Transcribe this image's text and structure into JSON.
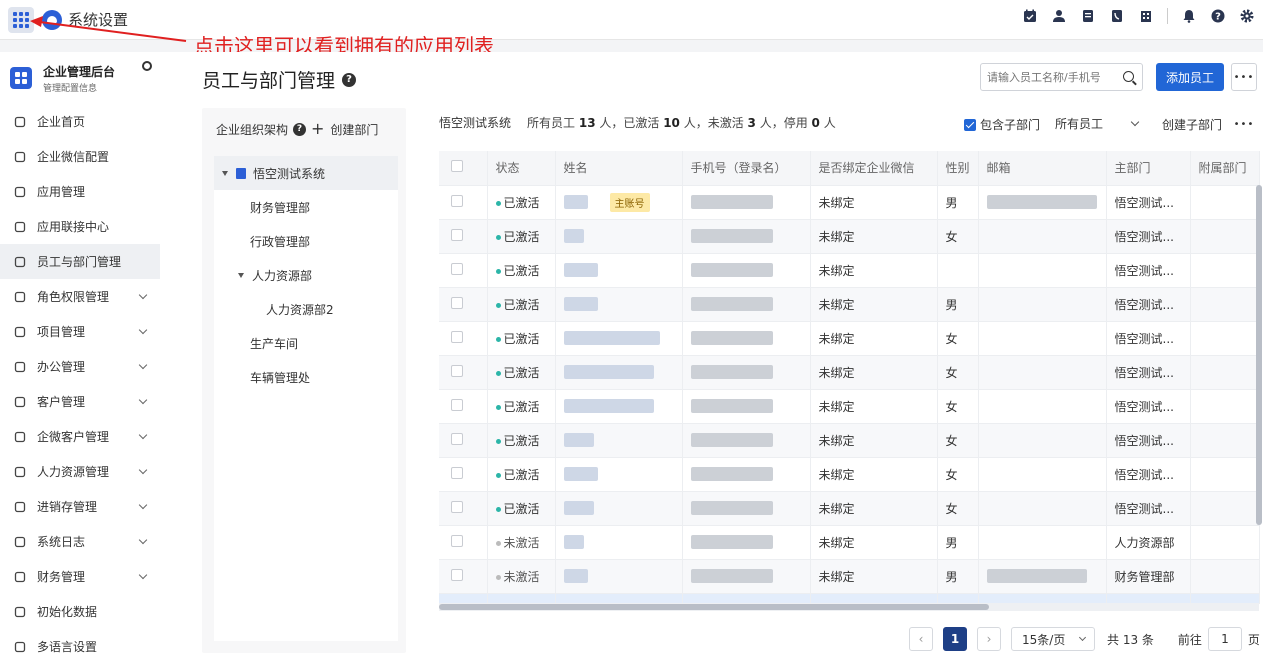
{
  "topbar": {
    "title": "系统设置",
    "annotation": "点击这里可以看到拥有的应用列表",
    "annotation_color": "#e02020",
    "icons": [
      "calendar-check-icon",
      "user-icon",
      "document-icon",
      "phone-book-icon",
      "building-icon",
      "bell-icon",
      "help-icon",
      "settings-icon"
    ]
  },
  "sidebar": {
    "title": "企业管理后台",
    "subtitle": "管理配置信息",
    "items": [
      {
        "label": "企业首页",
        "icon": "home-icon",
        "expandable": false
      },
      {
        "label": "企业微信配置",
        "icon": "wechat-icon",
        "expandable": false
      },
      {
        "label": "应用管理",
        "icon": "apps-icon",
        "expandable": false
      },
      {
        "label": "应用联接中心",
        "icon": "location-pin-icon",
        "expandable": false
      },
      {
        "label": "员工与部门管理",
        "icon": "users-icon",
        "expandable": false,
        "active": true
      },
      {
        "label": "角色权限管理",
        "icon": "role-icon",
        "expandable": true
      },
      {
        "label": "项目管理",
        "icon": "project-icon",
        "expandable": true
      },
      {
        "label": "办公管理",
        "icon": "office-icon",
        "expandable": true
      },
      {
        "label": "客户管理",
        "icon": "customer-icon",
        "expandable": true
      },
      {
        "label": "企微客户管理",
        "icon": "wecom-customer-icon",
        "expandable": true
      },
      {
        "label": "人力资源管理",
        "icon": "hr-icon",
        "expandable": true
      },
      {
        "label": "进销存管理",
        "icon": "inventory-icon",
        "expandable": true
      },
      {
        "label": "系统日志",
        "icon": "log-icon",
        "expandable": true
      },
      {
        "label": "财务管理",
        "icon": "finance-icon",
        "expandable": true
      },
      {
        "label": "初始化数据",
        "icon": "init-icon",
        "expandable": false
      },
      {
        "label": "多语言设置",
        "icon": "language-icon",
        "expandable": false
      }
    ]
  },
  "main": {
    "title": "员工与部门管理",
    "search_placeholder": "请输入员工名称/手机号",
    "add_button": "添加员工",
    "more": "•••",
    "tree": {
      "header": "企业组织架构",
      "create_label": "创建部门",
      "nodes": [
        {
          "label": "悟空测试系统",
          "level": 0,
          "caret": true,
          "selected": true,
          "building": true
        },
        {
          "label": "财务管理部",
          "level": 1
        },
        {
          "label": "行政管理部",
          "level": 1
        },
        {
          "label": "人力资源部",
          "level": 1,
          "caret": true
        },
        {
          "label": "人力资源部2",
          "level": 2
        },
        {
          "label": "生产车间",
          "level": 1
        },
        {
          "label": "车辆管理处",
          "level": 1
        }
      ]
    },
    "summary": {
      "system_name": "悟空测试系统",
      "total_prefix": "所有员工 ",
      "total": "13",
      "total_suffix": " 人，已激活 ",
      "active": "10",
      "active_suffix": " 人，未激活 ",
      "inactive": "3",
      "inactive_suffix": " 人，停用 ",
      "disabled": "0",
      "disabled_suffix": " 人"
    },
    "include_sub_label": "包含子部门",
    "employee_filter": "所有员工",
    "create_sub_label": "创建子部门",
    "table": {
      "columns": [
        "状态",
        "姓名",
        "手机号（登录名）",
        "是否绑定企业微信",
        "性别",
        "邮箱",
        "主部门",
        "附属部门"
      ],
      "rows": [
        {
          "status": "已激活",
          "active": true,
          "name_w": 24,
          "tag": "主账号",
          "phone_w": 82,
          "bind": "未绑定",
          "gender": "男",
          "email_w": 110,
          "dept": "悟空测试..."
        },
        {
          "status": "已激活",
          "active": true,
          "name_w": 20,
          "phone_w": 82,
          "bind": "未绑定",
          "gender": "女",
          "email_w": 0,
          "dept": "悟空测试..."
        },
        {
          "status": "已激活",
          "active": true,
          "name_w": 34,
          "phone_w": 82,
          "bind": "未绑定",
          "gender": "",
          "email_w": 0,
          "dept": "悟空测试..."
        },
        {
          "status": "已激活",
          "active": true,
          "name_w": 34,
          "phone_w": 82,
          "bind": "未绑定",
          "gender": "男",
          "email_w": 0,
          "dept": "悟空测试..."
        },
        {
          "status": "已激活",
          "active": true,
          "name_w": 96,
          "phone_w": 82,
          "bind": "未绑定",
          "gender": "女",
          "email_w": 0,
          "dept": "悟空测试..."
        },
        {
          "status": "已激活",
          "active": true,
          "name_w": 90,
          "phone_w": 82,
          "bind": "未绑定",
          "gender": "女",
          "email_w": 0,
          "dept": "悟空测试..."
        },
        {
          "status": "已激活",
          "active": true,
          "name_w": 90,
          "phone_w": 82,
          "bind": "未绑定",
          "gender": "女",
          "email_w": 0,
          "dept": "悟空测试..."
        },
        {
          "status": "已激活",
          "active": true,
          "name_w": 30,
          "phone_w": 82,
          "bind": "未绑定",
          "gender": "女",
          "email_w": 0,
          "dept": "悟空测试..."
        },
        {
          "status": "已激活",
          "active": true,
          "name_w": 34,
          "phone_w": 82,
          "bind": "未绑定",
          "gender": "女",
          "email_w": 0,
          "dept": "悟空测试..."
        },
        {
          "status": "已激活",
          "active": true,
          "name_w": 30,
          "phone_w": 82,
          "bind": "未绑定",
          "gender": "女",
          "email_w": 0,
          "dept": "悟空测试..."
        },
        {
          "status": "未激活",
          "active": false,
          "name_w": 20,
          "phone_w": 82,
          "bind": "未绑定",
          "gender": "男",
          "email_w": 0,
          "dept": "人力资源部"
        },
        {
          "status": "未激活",
          "active": false,
          "name_w": 24,
          "phone_w": 82,
          "bind": "未绑定",
          "gender": "男",
          "email_w": 100,
          "dept": "财务管理部"
        }
      ]
    },
    "pager": {
      "current": "1",
      "page_size": "15条/页",
      "total": "共 13 条",
      "goto_label": "前往",
      "goto_value": "1",
      "page_suffix": "页"
    }
  }
}
